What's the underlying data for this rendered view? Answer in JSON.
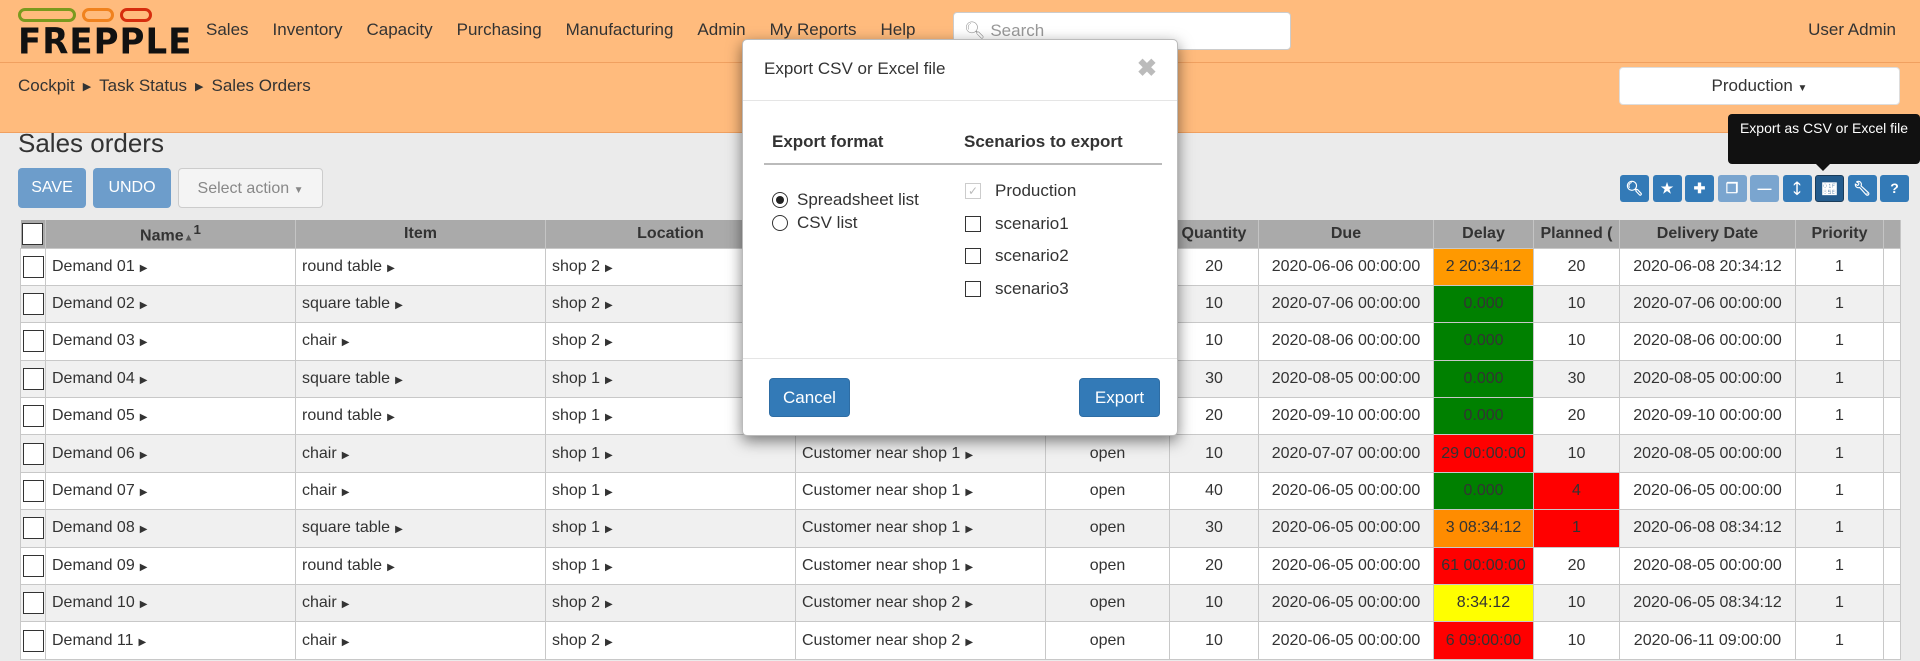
{
  "logo": {
    "text": "FREPPLE",
    "colors": [
      "#7a9a1e",
      "#f0821e",
      "#d62d0e"
    ]
  },
  "nav": [
    "Sales",
    "Inventory",
    "Capacity",
    "Purchasing",
    "Manufacturing",
    "Admin",
    "My Reports",
    "Help"
  ],
  "search": {
    "placeholder": "Search"
  },
  "user": "User Admin",
  "breadcrumb": [
    "Cockpit",
    "Task Status",
    "Sales Orders"
  ],
  "scenario": "Production",
  "page_title": "Sales orders",
  "toolbar": {
    "save": "SAVE",
    "undo": "UNDO",
    "select_action": "Select action"
  },
  "tool_icons": [
    "search-icon",
    "star-icon",
    "plus-icon",
    "copy-icon",
    "minus-icon",
    "arrow-up-icon",
    "arrow-down-icon",
    "wrench-icon",
    "question-icon"
  ],
  "tooltip": "Export as CSV or Excel file",
  "table": {
    "headers": [
      "",
      "Name",
      "Item",
      "Location",
      "",
      "",
      "Quantity",
      "Due",
      "Delay",
      "Planned (",
      "Delivery Date",
      "Priority"
    ],
    "sort_indicator": "1",
    "rows": [
      [
        "Demand 01",
        "round table",
        "shop 2",
        "",
        "",
        "20",
        "2020-06-06 00:00:00",
        "2 20:34:12",
        "20",
        "2020-06-08 20:34:12",
        "1"
      ],
      [
        "Demand 02",
        "square table",
        "shop 2",
        "",
        "",
        "10",
        "2020-07-06 00:00:00",
        "0.000",
        "10",
        "2020-07-06 00:00:00",
        "1"
      ],
      [
        "Demand 03",
        "chair",
        "shop 2",
        "",
        "",
        "10",
        "2020-08-06 00:00:00",
        "0.000",
        "10",
        "2020-08-06 00:00:00",
        "1"
      ],
      [
        "Demand 04",
        "square table",
        "shop 1",
        "",
        "",
        "30",
        "2020-08-05 00:00:00",
        "0.000",
        "30",
        "2020-08-05 00:00:00",
        "1"
      ],
      [
        "Demand 05",
        "round table",
        "shop 1",
        "",
        "",
        "20",
        "2020-09-10 00:00:00",
        "0.000",
        "20",
        "2020-09-10 00:00:00",
        "1"
      ],
      [
        "Demand 06",
        "chair",
        "shop 1",
        "Customer near shop 1",
        "open",
        "10",
        "2020-07-07 00:00:00",
        "29 00:00:00",
        "10",
        "2020-08-05 00:00:00",
        "1"
      ],
      [
        "Demand 07",
        "chair",
        "shop 1",
        "Customer near shop 1",
        "open",
        "40",
        "2020-06-05 00:00:00",
        "0.000",
        "4",
        "2020-06-05 00:00:00",
        "1"
      ],
      [
        "Demand 08",
        "square table",
        "shop 1",
        "Customer near shop 1",
        "open",
        "30",
        "2020-06-05 00:00:00",
        "3 08:34:12",
        "1",
        "2020-06-08 08:34:12",
        "1"
      ],
      [
        "Demand 09",
        "round table",
        "shop 1",
        "Customer near shop 1",
        "open",
        "20",
        "2020-06-05 00:00:00",
        "61 00:00:00",
        "20",
        "2020-08-05 00:00:00",
        "1"
      ],
      [
        "Demand 10",
        "chair",
        "shop 2",
        "Customer near shop 2",
        "open",
        "10",
        "2020-06-05 00:00:00",
        "8:34:12",
        "10",
        "2020-06-05 08:34:12",
        "1"
      ],
      [
        "Demand 11",
        "chair",
        "shop 2",
        "Customer near shop 2",
        "open",
        "10",
        "2020-06-05 00:00:00",
        "6 09:00:00",
        "10",
        "2020-06-11 09:00:00",
        "1"
      ]
    ],
    "delay_colors": [
      "#ff9900",
      "#008000",
      "#008000",
      "#008000",
      "#008000",
      "#ff0000",
      "#008000",
      "#ff8c00",
      "#ff0000",
      "#ffff00",
      "#ff0000"
    ],
    "planned_colors": [
      null,
      null,
      null,
      null,
      null,
      null,
      "#ff0000",
      "#ff0000",
      null,
      null,
      null
    ]
  },
  "modal": {
    "title": "Export CSV or Excel file",
    "format_heading": "Export format",
    "scenarios_heading": "Scenarios to export",
    "formats": [
      {
        "label": "Spreadsheet list",
        "selected": true
      },
      {
        "label": "CSV list",
        "selected": false
      }
    ],
    "scenarios": [
      {
        "label": "Production",
        "checked": true,
        "disabled": true
      },
      {
        "label": "scenario1",
        "checked": false
      },
      {
        "label": "scenario2",
        "checked": false
      },
      {
        "label": "scenario3",
        "checked": false
      }
    ],
    "cancel": "Cancel",
    "export": "Export"
  }
}
